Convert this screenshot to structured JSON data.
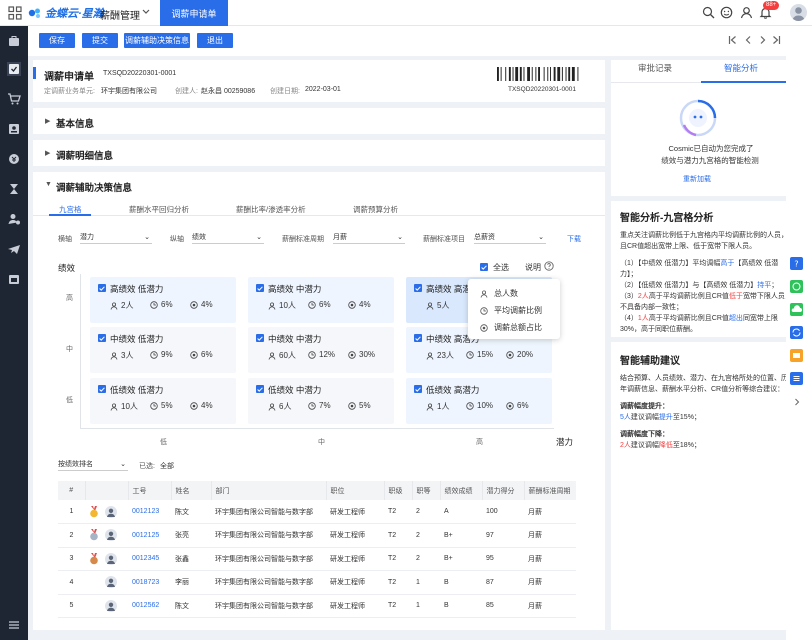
{
  "topbar": {
    "logo": "金蝶云·星瀚",
    "app_title": "薪酬管理",
    "active_tab": "调薪申请单",
    "notification_badge": "88+"
  },
  "toolbar": {
    "save": "保存",
    "submit": "提交",
    "decision_info": "调薪辅助决策信息",
    "exit": "退出"
  },
  "header": {
    "title": "调薪申请单",
    "bill_no": "TXSQD20220301-0001",
    "unit_label": "定调薪业务单元:",
    "unit_value": "环宇集团有限公司",
    "creator_label": "创建人:",
    "creator_value": "赵永昌 00259086",
    "date_label": "创建日期:",
    "date_value": "2022-03-01",
    "barcode_text": "TXSQD20220301-0001"
  },
  "sections": {
    "basic": "基本信息",
    "detail": "调薪明细信息",
    "decision": "调薪辅助决策信息"
  },
  "subtabs": [
    "九宫格",
    "薪酬水平回归分析",
    "薪酬比率/渗透率分析",
    "调薪预算分析"
  ],
  "filters": {
    "x_label": "横轴",
    "x_value": "潜力",
    "y_label": "纵轴",
    "y_value": "绩效",
    "period_label": "薪酬标准周期",
    "period_value": "月薪",
    "item_label": "薪酬标准项目",
    "item_value": "总薪资",
    "download": "下载"
  },
  "grid": {
    "y_axis_title": "绩效",
    "x_axis_title": "潜力",
    "select_all": "全选",
    "explain": "说明",
    "y_ticks": [
      "高",
      "中",
      "低"
    ],
    "x_ticks": [
      "低",
      "中",
      "高"
    ],
    "boxes": [
      {
        "title": "高绩效 低潜力",
        "count": "2人",
        "avg": "6%",
        "ratio": "4%"
      },
      {
        "title": "高绩效 中潜力",
        "count": "10人",
        "avg": "6%",
        "ratio": "4%"
      },
      {
        "title": "高绩效 高潜力",
        "count": "5人",
        "avg": "",
        "ratio": ""
      },
      {
        "title": "中绩效 低潜力",
        "count": "3人",
        "avg": "9%",
        "ratio": "6%"
      },
      {
        "title": "中绩效 中潜力",
        "count": "60人",
        "avg": "12%",
        "ratio": "30%"
      },
      {
        "title": "中绩效 高潜力",
        "count": "23人",
        "avg": "15%",
        "ratio": "20%"
      },
      {
        "title": "低绩效 低潜力",
        "count": "10人",
        "avg": "5%",
        "ratio": "4%"
      },
      {
        "title": "低绩效 中潜力",
        "count": "6人",
        "avg": "7%",
        "ratio": "5%"
      },
      {
        "title": "低绩效 高潜力",
        "count": "1人",
        "avg": "10%",
        "ratio": "6%"
      }
    ]
  },
  "popup": {
    "items": [
      "总人数",
      "平均调薪比例",
      "调薪总额占比"
    ]
  },
  "list": {
    "sort_label": "按绩效排名",
    "selected_label": "已选:",
    "selected_value": "全部",
    "columns": [
      "#",
      "工号",
      "姓名",
      "部门",
      "职位",
      "职级",
      "职等",
      "绩效成绩",
      "潜力得分",
      "薪酬标准周期"
    ],
    "rows": [
      [
        "1",
        "0012123",
        "陈文",
        "环宇集团有限公司智能与数字部",
        "研发工程师",
        "T2",
        "2",
        "A",
        "100",
        "月薪"
      ],
      [
        "2",
        "0012125",
        "张亮",
        "环宇集团有限公司智能与数字部",
        "研发工程师",
        "T2",
        "2",
        "B+",
        "97",
        "月薪"
      ],
      [
        "3",
        "0012345",
        "张鑫",
        "环宇集团有限公司智能与数字部",
        "研发工程师",
        "T2",
        "2",
        "B+",
        "95",
        "月薪"
      ],
      [
        "4",
        "0018723",
        "李丽",
        "环宇集团有限公司智能与数字部",
        "研发工程师",
        "T2",
        "1",
        "B",
        "87",
        "月薪"
      ],
      [
        "5",
        "0012562",
        "陈文",
        "环宇集团有限公司智能与数字部",
        "研发工程师",
        "T2",
        "1",
        "B",
        "85",
        "月薪"
      ]
    ]
  },
  "right_panel": {
    "tab_approval": "审批记录",
    "tab_analysis": "智能分析",
    "status_line1": "Cosmic已自动为您完成了",
    "status_line2": "绩效与潜力九宫格的智能检测",
    "reload": "重新加载",
    "analysis_title": "智能分析-九宫格分析",
    "analysis_intro": "重点关注调薪比例低于九宫格内平均调薪比例的人员，且CR值超出宽带上限、低于宽带下限人员。",
    "point1_a": "（1）【中绩效 低潜力】平均调幅",
    "point1_b": "高于",
    "point1_c": "【高绩效 低潜力】；",
    "point2_a": "（2）【低绩效 低潜力】与【高绩效 低潜力】",
    "point2_b": "持平",
    "point2_c": "；",
    "point3_a": "（3）",
    "point3_b": "2人",
    "point3_c": "高于平均调薪比例且CR值",
    "point3_d": "低于",
    "point3_e": "宽带下限人员，不具备内部一致性；",
    "point4_a": "（4）",
    "point4_b": "1人",
    "point4_c": "高于平均调薪比例且CR值",
    "point4_d": "超出",
    "point4_e": "同宽带上限30%，高于同职位薪酬。",
    "suggest_title": "智能辅助建议",
    "suggest_intro": "结合预算、人员绩效、潜力、在九宫格所处的位置、历年调薪信息、薪酬水平分析、CR值分析等综合建议：",
    "up_title": "调薪幅度提升：",
    "up_a": "5人",
    "up_b": "建议调幅",
    "up_c": "提升",
    "up_d": "至15%；",
    "down_title": "调薪幅度下降：",
    "down_a": "2人",
    "down_b": "建议调幅",
    "down_c": "降低",
    "down_d": "至18%；"
  },
  "colors": {
    "primary": "#2a6de8",
    "sidebar": "#1f2633",
    "danger": "#f53f3f"
  }
}
